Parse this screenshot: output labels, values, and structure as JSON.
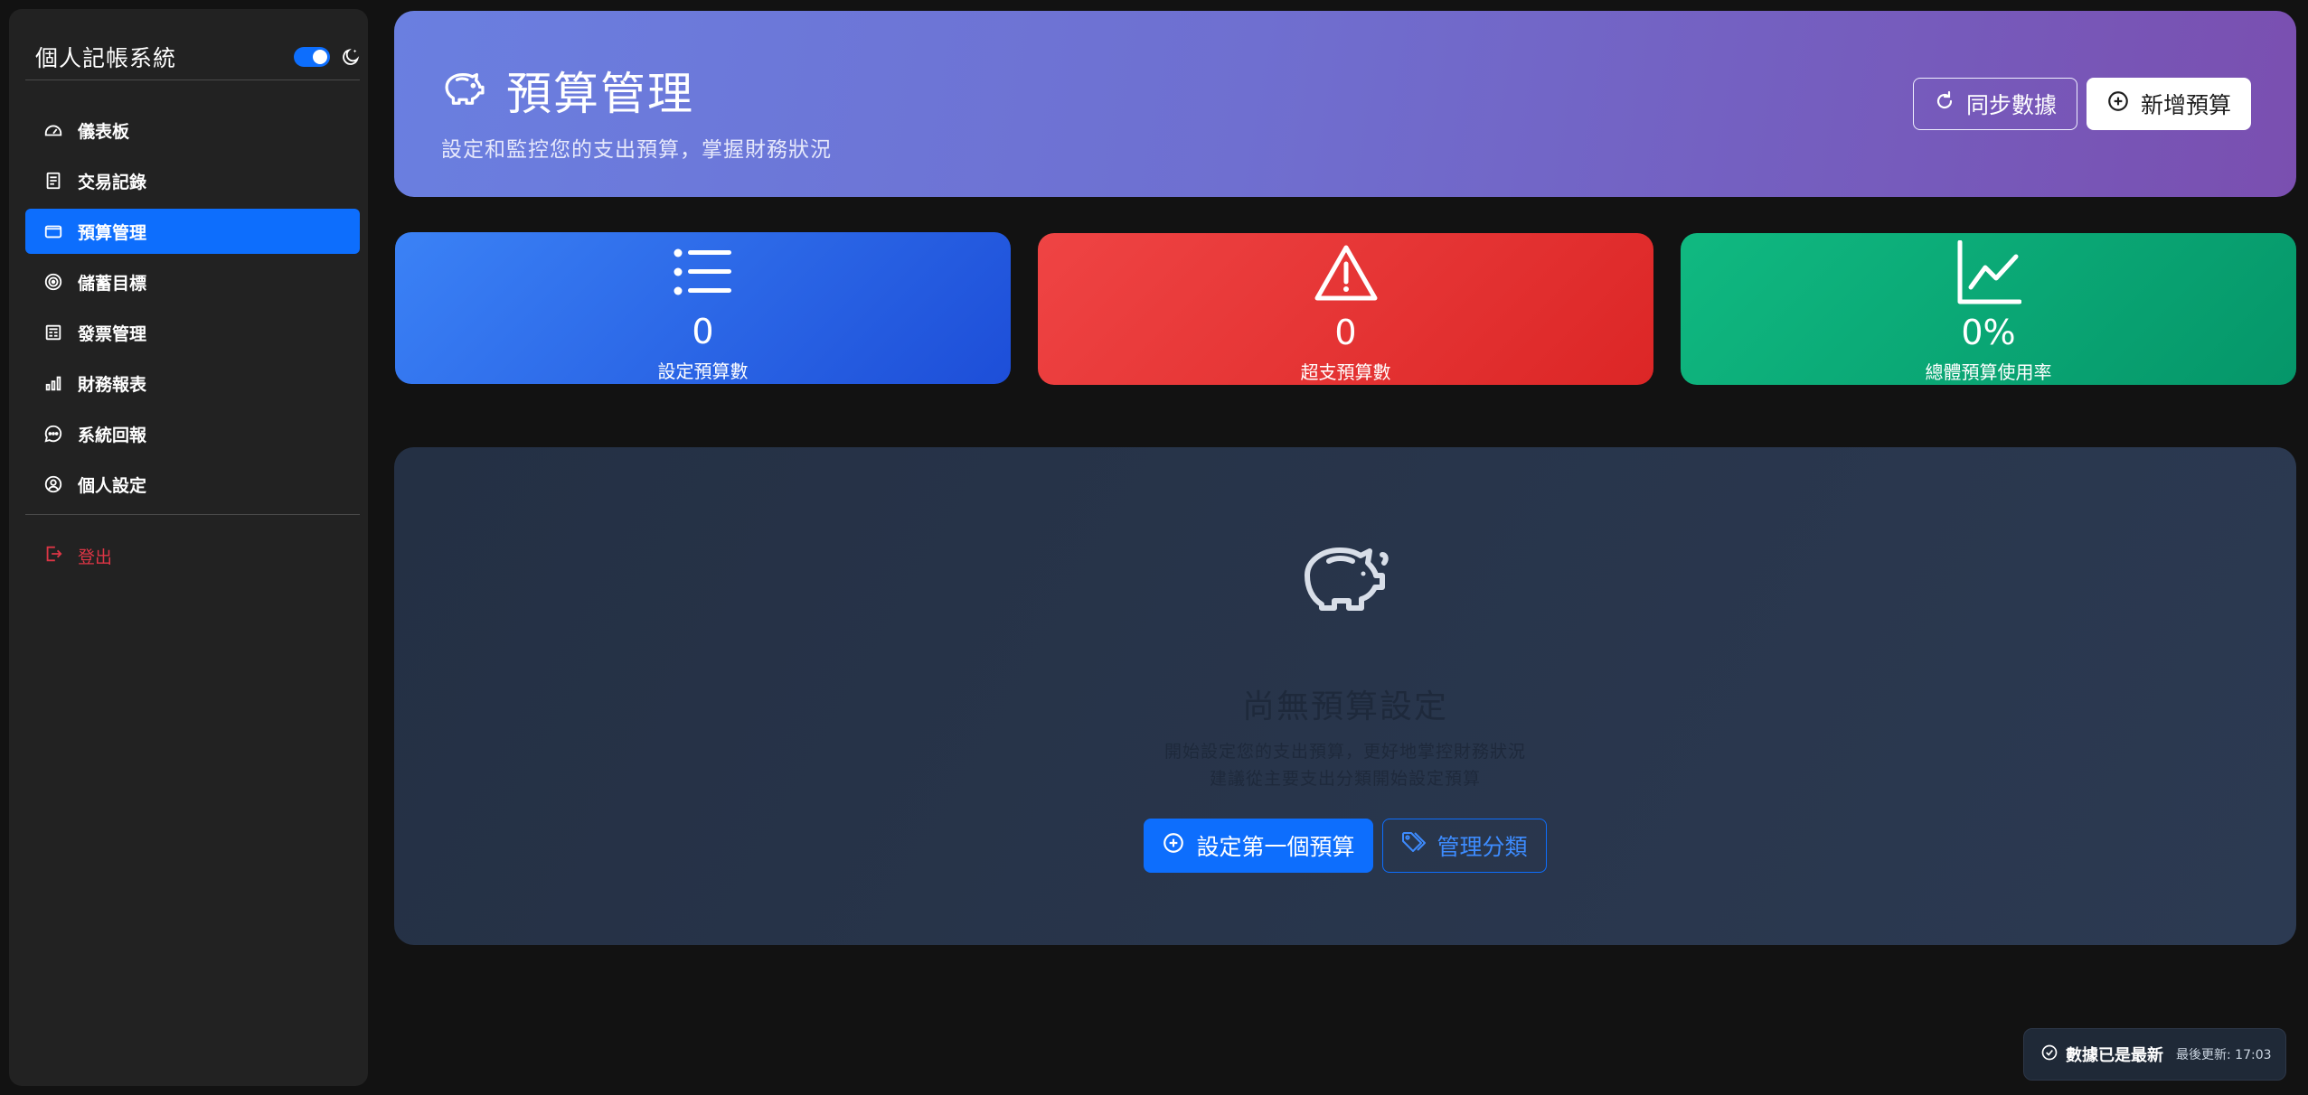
{
  "sidebar": {
    "app_title": "個人記帳系統",
    "items": [
      {
        "label": "儀表板",
        "icon": "speedometer-icon"
      },
      {
        "label": "交易記錄",
        "icon": "receipt-icon"
      },
      {
        "label": "預算管理",
        "icon": "wallet-icon",
        "active": true
      },
      {
        "label": "儲蓄目標",
        "icon": "target-icon"
      },
      {
        "label": "發票管理",
        "icon": "invoice-icon"
      },
      {
        "label": "財務報表",
        "icon": "bar-chart-icon"
      },
      {
        "label": "系統回報",
        "icon": "chat-dots-icon"
      },
      {
        "label": "個人設定",
        "icon": "person-circle-icon"
      }
    ],
    "logout_label": "登出"
  },
  "hero": {
    "title": "預算管理",
    "subtitle": "設定和監控您的支出預算，掌握財務狀況",
    "sync_button": "同步數據",
    "add_button": "新增預算"
  },
  "stats": [
    {
      "value": "0",
      "label": "設定預算數",
      "icon": "list-icon",
      "color": "#2563eb"
    },
    {
      "value": "0",
      "label": "超支預算數",
      "icon": "warning-triangle-icon",
      "color": "#e53e3e"
    },
    {
      "value": "0%",
      "label": "總體預算使用率",
      "icon": "line-graph-icon",
      "color": "#059669"
    }
  ],
  "empty_state": {
    "title": "尚無預算設定",
    "desc_line1": "開始設定您的支出預算，更好地掌控財務狀況",
    "desc_line2": "建議從主要支出分類開始設定預算",
    "primary_button": "設定第一個預算",
    "secondary_button": "管理分類"
  },
  "toast": {
    "message": "數據已是最新",
    "time": "最後更新: 17:03"
  },
  "colors": {
    "accent": "#0d6efd",
    "danger": "#dc3545",
    "background": "#121212",
    "sidebar": "#222222"
  }
}
